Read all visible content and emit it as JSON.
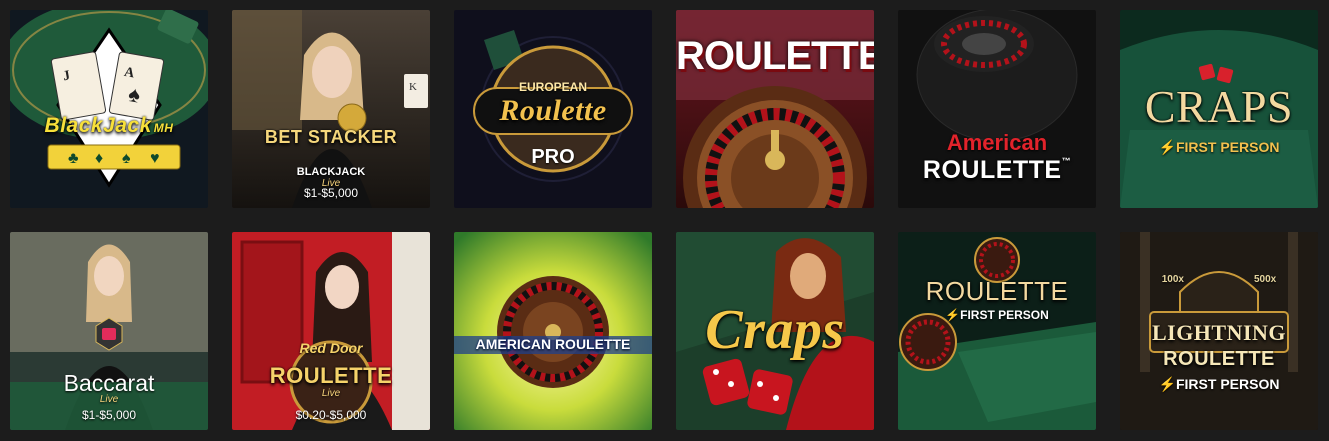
{
  "colors": {
    "background": "#1c1c1c",
    "gold": "#f2c14e",
    "felt_green": "#1f5a3a",
    "casino_red": "#b3121a"
  },
  "tiles": [
    {
      "title": "BlackJack",
      "suffix": "MH",
      "price": ""
    },
    {
      "title": "BET STACKER",
      "sub": "BLACKJACK",
      "live": "Live",
      "price": "$1-$5,000"
    },
    {
      "top": "EUROPEAN",
      "title": "Roulette",
      "sub": "PRO",
      "price": ""
    },
    {
      "title": "ROULETTE",
      "price": ""
    },
    {
      "top": "American",
      "title": "ROULETTE",
      "tm": "™",
      "price": ""
    },
    {
      "title": "CRAPS",
      "sub": "FIRST PERSON",
      "price": ""
    },
    {
      "title": "Baccarat",
      "live": "Live",
      "price": "$1-$5,000"
    },
    {
      "top": "Red Door",
      "title": "ROULETTE",
      "live": "Live",
      "price": "$0.20-$5,000"
    },
    {
      "title": "AMERICAN ROULETTE",
      "price": ""
    },
    {
      "title": "Craps",
      "price": ""
    },
    {
      "title": "ROULETTE",
      "sub": "FIRST PERSON",
      "price": ""
    },
    {
      "top": "LIGHTNING",
      "title": "ROULETTE",
      "sub": "FIRST PERSON",
      "badge_left": "100x",
      "badge_right": "500x",
      "price": ""
    }
  ]
}
